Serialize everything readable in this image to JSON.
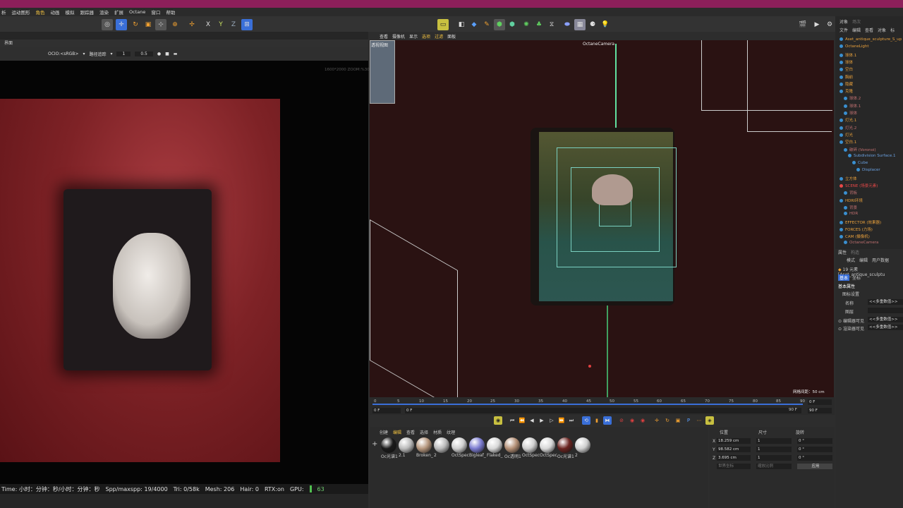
{
  "menu": [
    "析",
    "运动图形",
    "角色",
    "动画",
    "模拟",
    "跟踪器",
    "渲染",
    "扩展",
    "Octane",
    "窗口",
    "帮助"
  ],
  "left_panel": {
    "header": "界面",
    "ocio": "OCIO:<sRGB>",
    "path_trace": "路径追踪",
    "v1": "1",
    "v2": "0.5",
    "overlay": "1600*2000 ZOOM:%30"
  },
  "status": {
    "time": "Time: 小时：分钟：秒/小时：分钟：秒",
    "spp": "Spp/maxspp: 19/4000",
    "tri": "Tri: 0/58k",
    "mesh": "Mesh: 206",
    "hair": "Hair: 0",
    "rtx": "RTX:on",
    "gpu": "GPU:",
    "gpu_val": "63"
  },
  "viewport": {
    "menu": [
      "查看",
      "摄像机",
      "显示",
      "选项",
      "过滤",
      "面板"
    ],
    "label": "透视视图",
    "camera": "OctaneCamera",
    "grid": "网格间距：50 cm"
  },
  "timeline": {
    "ticks": [
      "0",
      "5",
      "10",
      "15",
      "20",
      "25",
      "30",
      "35",
      "40",
      "45",
      "50",
      "55",
      "60",
      "65",
      "70",
      "75",
      "80",
      "85",
      "90"
    ],
    "start": "0 F",
    "start2": "0 F",
    "end": "90 F",
    "end2": "90 F",
    "current": "0 F"
  },
  "materials": {
    "tabs": [
      "创建",
      "编辑",
      "查看",
      "选择",
      "材质",
      "纹理"
    ],
    "items": [
      {
        "label": "Oc光谱1",
        "color": "#1a1a1a"
      },
      {
        "label": "2.1",
        "color": "#bbbbbb"
      },
      {
        "label": "Broken_",
        "color": "#b5967d"
      },
      {
        "label": "2",
        "color": "#bbbbbb"
      },
      {
        "label": "OctSpec",
        "color": "#cfcfcf"
      },
      {
        "label": "Bigleaf_",
        "color": "#7b7bd0"
      },
      {
        "label": "Flaked_",
        "color": "#d8d8d8"
      },
      {
        "label": "Oc透明1",
        "color": "#b38f75"
      },
      {
        "label": "OctSpec",
        "color": "#cfcfcf"
      },
      {
        "label": "OctSpec",
        "color": "#d8d8d8"
      },
      {
        "label": "Oc光谱1",
        "color": "#6a2420"
      },
      {
        "label": "2",
        "color": "#cfcfcf"
      }
    ]
  },
  "coords": {
    "h_pos": "位置",
    "h_size": "尺寸",
    "h_rot": "旋转",
    "x": "18.259 cm",
    "y": "98.582 cm",
    "z": "3.695 cm",
    "sx": "1",
    "sy": "1",
    "sz": "1",
    "h": "0 °",
    "p": "0 °",
    "b": "0 °",
    "world": "世界坐标",
    "scale": "缩放比例",
    "apply": "应用"
  },
  "objects": {
    "tabs": [
      "对象",
      "场次"
    ],
    "menu": [
      "文件",
      "编辑",
      "查看",
      "对象",
      "标"
    ],
    "items": [
      {
        "label": "Aset_antique_sculpture_S_up",
        "color": "#e8a03c",
        "indent": 0
      },
      {
        "label": "OctaneLight",
        "color": "#e8a03c",
        "indent": 0
      },
      {
        "label": "球体.1",
        "color": "#e8a03c",
        "indent": 0
      },
      {
        "label": "球体",
        "color": "#e8a03c",
        "indent": 0
      },
      {
        "label": "空白",
        "color": "#e8a03c",
        "indent": 0
      },
      {
        "label": "胸前",
        "color": "#e8a03c",
        "indent": 0
      },
      {
        "label": "隐藏",
        "color": "#e8a03c",
        "indent": 0
      },
      {
        "label": "克隆",
        "color": "#e8a03c",
        "indent": 0
      },
      {
        "label": "球体.2",
        "color": "#c07070",
        "indent": 1
      },
      {
        "label": "球体.1",
        "color": "#c07070",
        "indent": 1
      },
      {
        "label": "球体",
        "color": "#c07070",
        "indent": 1
      },
      {
        "label": "灯光.1",
        "color": "#e8a03c",
        "indent": 0
      },
      {
        "label": "灯光.2",
        "color": "#c07070",
        "indent": 0
      },
      {
        "label": "灯光",
        "color": "#e8a03c",
        "indent": 0
      },
      {
        "label": "空白.1",
        "color": "#e8a03c",
        "indent": 0
      },
      {
        "label": "破碎 (Voronoi)",
        "color": "#c07070",
        "indent": 1
      },
      {
        "label": "Subdivision Surface.1",
        "color": "#6aa0e0",
        "indent": 2
      },
      {
        "label": "Cube",
        "color": "#6aa0e0",
        "indent": 3
      },
      {
        "label": "Displacer",
        "color": "#6aa0e0",
        "indent": 4
      },
      {
        "label": "立方体",
        "color": "#e8a03c",
        "indent": 0
      },
      {
        "label": "SCENE (场景元素)",
        "color": "#e84848",
        "indent": 0
      },
      {
        "label": "背板",
        "color": "#c07070",
        "indent": 1
      },
      {
        "label": "HDRI环境",
        "color": "#e8a03c",
        "indent": 0
      },
      {
        "label": "背景",
        "color": "#c07070",
        "indent": 1
      },
      {
        "label": "HDR",
        "color": "#c07070",
        "indent": 1
      },
      {
        "label": "EFFECTOR (效果器)",
        "color": "#e8a03c",
        "indent": 0
      },
      {
        "label": "FORCES (力场)",
        "color": "#e8a03c",
        "indent": 0
      },
      {
        "label": "CAM (摄像机)",
        "color": "#e8a03c",
        "indent": 0
      },
      {
        "label": "OctaneCamera",
        "color": "#c07070",
        "indent": 1
      }
    ]
  },
  "attributes": {
    "tabs": [
      "属性",
      "构造"
    ],
    "menu": [
      "模式",
      "编辑",
      "用户数据"
    ],
    "elements": "19 元素 [Aset_antique_sculptu",
    "subtabs": [
      "基本",
      "坐标"
    ],
    "section": "基本属性",
    "sub": "图标设置",
    "rows": [
      {
        "label": "名称",
        "value": "<<多重数值>>"
      },
      {
        "label": "图层",
        "value": ""
      },
      {
        "label": "编辑器可见",
        "value": "<<多重数值>>"
      },
      {
        "label": "渲染器可见",
        "value": "<<多重数值>>"
      }
    ]
  }
}
